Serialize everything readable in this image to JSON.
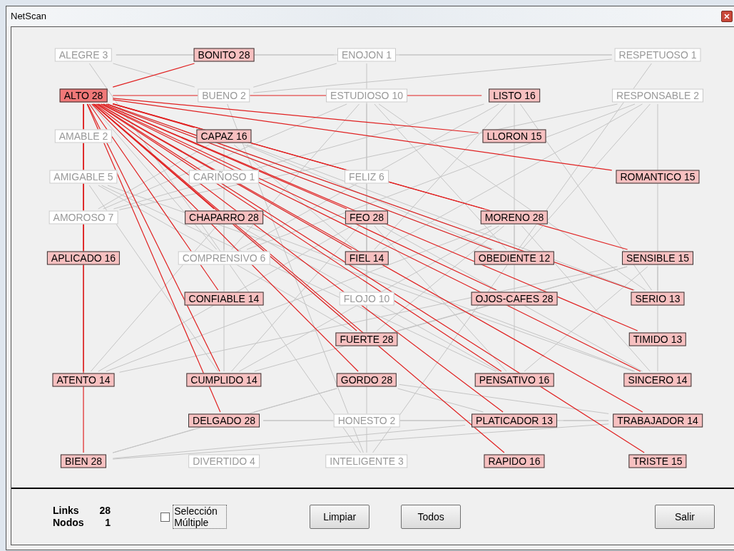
{
  "window": {
    "title": "NetScan"
  },
  "graph": {
    "columns": [
      [
        {
          "label": "ALEGRE 3",
          "selected": false,
          "linked": false
        },
        {
          "label": "ALTO 28",
          "selected": true,
          "linked": false
        },
        {
          "label": "AMABLE 2",
          "selected": false,
          "linked": false
        },
        {
          "label": "AMIGABLE 5",
          "selected": false,
          "linked": false
        },
        {
          "label": "AMOROSO 7",
          "selected": false,
          "linked": false
        },
        {
          "label": "APLICADO 16",
          "selected": false,
          "linked": true
        },
        null,
        null,
        {
          "label": "ATENTO 14",
          "selected": false,
          "linked": true
        },
        null,
        {
          "label": "BIEN 28",
          "selected": false,
          "linked": true
        }
      ],
      [
        {
          "label": "BONITO 28",
          "selected": false,
          "linked": true
        },
        {
          "label": "BUENO 2",
          "selected": false,
          "linked": false
        },
        {
          "label": "CAPAZ 16",
          "selected": false,
          "linked": true
        },
        {
          "label": "CARIÑOSO 1",
          "selected": false,
          "linked": false
        },
        {
          "label": "CHAPARRO 28",
          "selected": false,
          "linked": true
        },
        {
          "label": "COMPRENSIVO 6",
          "selected": false,
          "linked": false
        },
        {
          "label": "CONFIABLE 14",
          "selected": false,
          "linked": true
        },
        null,
        {
          "label": "CUMPLIDO 14",
          "selected": false,
          "linked": true
        },
        {
          "label": "DELGADO 28",
          "selected": false,
          "linked": true
        },
        {
          "label": "DIVERTIDO 4",
          "selected": false,
          "linked": false
        }
      ],
      [
        {
          "label": "ENOJON 1",
          "selected": false,
          "linked": false
        },
        {
          "label": "ESTUDIOSO 10",
          "selected": false,
          "linked": false
        },
        null,
        {
          "label": "FELIZ 6",
          "selected": false,
          "linked": false
        },
        {
          "label": "FEO 28",
          "selected": false,
          "linked": true
        },
        {
          "label": "FIEL 14",
          "selected": false,
          "linked": true
        },
        {
          "label": "FLOJO 10",
          "selected": false,
          "linked": false
        },
        {
          "label": "FUERTE 28",
          "selected": false,
          "linked": true
        },
        {
          "label": "GORDO 28",
          "selected": false,
          "linked": true
        },
        {
          "label": "HONESTO 2",
          "selected": false,
          "linked": false
        },
        {
          "label": "INTELIGENTE 3",
          "selected": false,
          "linked": false
        }
      ],
      [
        null,
        {
          "label": "LISTO 16",
          "selected": false,
          "linked": true
        },
        {
          "label": "LLORON 15",
          "selected": false,
          "linked": true
        },
        null,
        {
          "label": "MORENO 28",
          "selected": false,
          "linked": true
        },
        {
          "label": "OBEDIENTE 12",
          "selected": false,
          "linked": true
        },
        {
          "label": "OJOS-CAFES 28",
          "selected": false,
          "linked": true
        },
        null,
        {
          "label": "PENSATIVO 16",
          "selected": false,
          "linked": true
        },
        {
          "label": "PLATICADOR 13",
          "selected": false,
          "linked": true
        },
        {
          "label": "RAPIDO 16",
          "selected": false,
          "linked": true
        }
      ],
      [
        {
          "label": "RESPETUOSO 1",
          "selected": false,
          "linked": false
        },
        {
          "label": "RESPONSABLE 2",
          "selected": false,
          "linked": false
        },
        null,
        {
          "label": "ROMANTICO 15",
          "selected": false,
          "linked": true
        },
        null,
        {
          "label": "SENSIBLE 15",
          "selected": false,
          "linked": true
        },
        {
          "label": "SERIO 13",
          "selected": false,
          "linked": true
        },
        {
          "label": "TIMIDO 13",
          "selected": false,
          "linked": true
        },
        {
          "label": "SINCERO 14",
          "selected": false,
          "linked": true
        },
        {
          "label": "TRABAJADOR 14",
          "selected": false,
          "linked": true
        },
        {
          "label": "TRISTE 15",
          "selected": false,
          "linked": true
        }
      ]
    ]
  },
  "stats": [
    {
      "label": "Links",
      "value": "28"
    },
    {
      "label": "Nodos",
      "value": "1"
    }
  ],
  "multi_select": {
    "label": "Selección Múltiple",
    "checked": false
  },
  "buttons": [
    {
      "label": "Limpiar"
    },
    {
      "label": "Todos"
    },
    {
      "label": "Salir"
    }
  ]
}
